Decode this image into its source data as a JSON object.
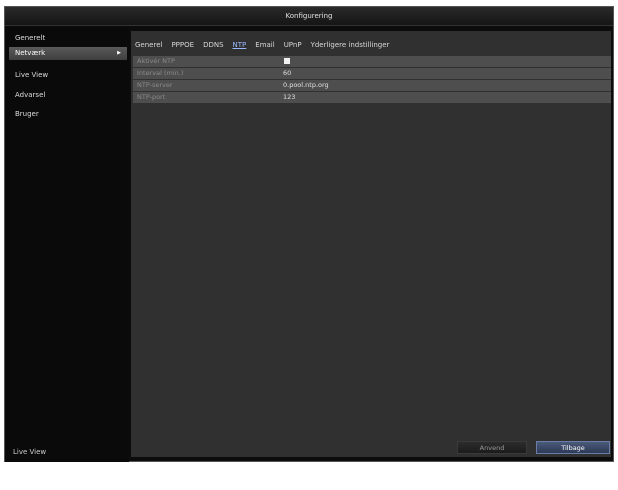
{
  "window": {
    "title": "Konfigurering"
  },
  "sidebar": {
    "items": [
      {
        "label": "Generelt",
        "active": false
      },
      {
        "label": "Netværk",
        "active": true
      },
      {
        "label": "Live View",
        "active": false
      },
      {
        "label": "Advarsel",
        "active": false
      },
      {
        "label": "Bruger",
        "active": false
      }
    ],
    "bottom_label": "Live View",
    "active_arrow": "▶"
  },
  "tabs": [
    {
      "label": "Generel",
      "active": false
    },
    {
      "label": "PPPOE",
      "active": false
    },
    {
      "label": "DDNS",
      "active": false
    },
    {
      "label": "NTP",
      "active": true
    },
    {
      "label": "Email",
      "active": false
    },
    {
      "label": "UPnP",
      "active": false
    },
    {
      "label": "Yderligere indstillinger",
      "active": false
    }
  ],
  "ntp": {
    "enable_label": "Aktivér NTP",
    "enable_checked": false,
    "interval_label": "Interval (min.)",
    "interval_value": "60",
    "server_label": "NTP-server",
    "server_value": "0.pool.ntp.org",
    "port_label": "NTP-port",
    "port_value": "123"
  },
  "footer": {
    "apply_label": "Anvend",
    "back_label": "Tilbage"
  }
}
